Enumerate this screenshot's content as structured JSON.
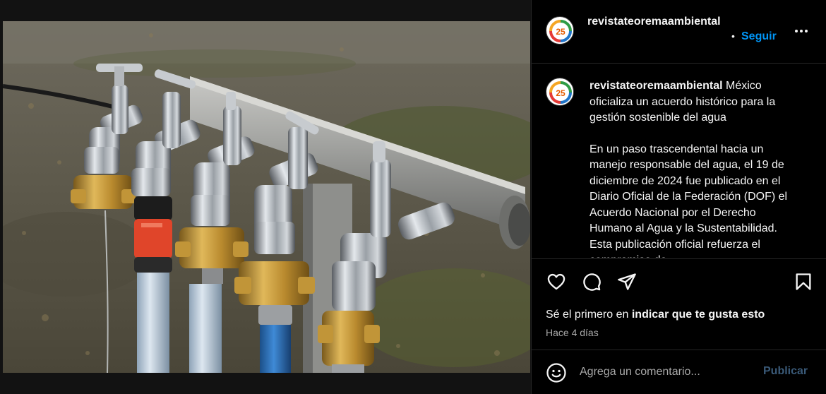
{
  "post": {
    "username": "revistateoremaambiental",
    "follow_label": "Seguir",
    "separator": "•",
    "more_icon": "more-horizontal-icon",
    "avatar_logo_text": "25"
  },
  "caption": {
    "username": "revistateoremaambiental",
    "title": "México oficializa un acuerdo histórico para la gestión sostenible del agua",
    "body": "En un paso trascendental hacia un manejo responsable del agua, el 19 de diciembre de 2024 fue publicado en el Diario Oficial de la Federación (DOF) el Acuerdo Nacional por el Derecho Humano al Agua y la Sustentabilidad. Esta publicación oficial refuerza el compromiso de"
  },
  "actions": {
    "like_icon": "heart-icon",
    "comment_icon": "comment-icon",
    "share_icon": "share-icon",
    "save_icon": "bookmark-icon",
    "likes_prefix": "Sé el primero en ",
    "likes_link": "indicar que te gusta esto",
    "time_ago": "Hace 4 días"
  },
  "comment": {
    "emoji_icon": "emoji-icon",
    "placeholder": "Agrega un comentario...",
    "publish_label": "Publicar"
  },
  "colors": {
    "accent": "#0095f6",
    "background": "#000000",
    "text": "#f5f5f5",
    "muted": "#a8a8a8",
    "publish_disabled": "#3a5a78",
    "hose_blue": "#2b6fb5",
    "connector_orange": "#e0452a"
  }
}
